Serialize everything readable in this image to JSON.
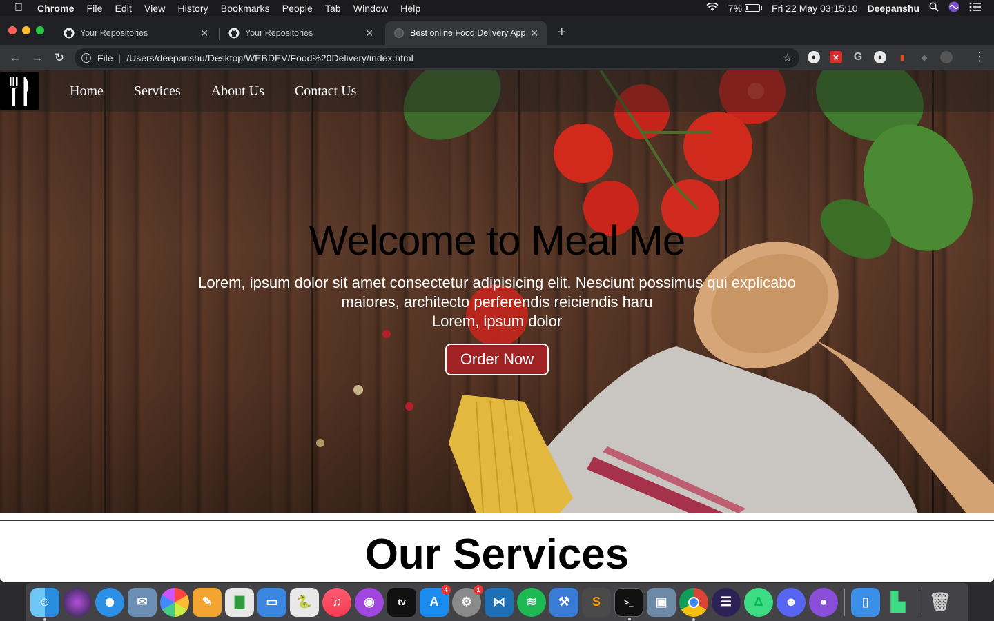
{
  "menubar": {
    "app": "Chrome",
    "items": [
      "File",
      "Edit",
      "View",
      "History",
      "Bookmarks",
      "People",
      "Tab",
      "Window",
      "Help"
    ],
    "battery": "7%",
    "battery_level": 0.07,
    "datetime": "Fri 22 May  03:15:10",
    "user": "Deepanshu"
  },
  "tabs": [
    {
      "title": "Your Repositories",
      "icon": "github-icon",
      "active": false
    },
    {
      "title": "Your Repositories",
      "icon": "github-icon",
      "active": false
    },
    {
      "title": "Best online Food Delivery App",
      "icon": "globe-icon",
      "active": true
    }
  ],
  "address": {
    "scheme": "File",
    "url": "/Users/deepanshu/Desktop/WEBDEV/Food%20Delivery/index.html"
  },
  "site": {
    "nav": [
      "Home",
      "Services",
      "About Us",
      "Contact Us"
    ],
    "hero_title": "Welcome to Meal Me",
    "hero_line1": "Lorem, ipsum dolor sit amet consectetur adipisicing elit. Nesciunt possimus qui explicabo",
    "hero_line2": "maiores, architecto perferendis reiciendis haru",
    "hero_line3": "Lorem, ipsum dolor",
    "order_button": "Order Now",
    "services_heading": "Our Services"
  },
  "dock": {
    "apps": [
      "Finder",
      "Siri",
      "Safari",
      "Preview",
      "Photos",
      "Pages",
      "Numbers",
      "Keynote",
      "Python",
      "Music",
      "Podcasts",
      "tv",
      "App Store",
      "System Preferences",
      "Visual Studio Code",
      "Spotify",
      "Xcode",
      "Sublime Text",
      "Terminal",
      "Image Capture",
      "Google Chrome",
      "Eclipse",
      "Android Studio",
      "Discord",
      "GitHub Desktop",
      "Simulator",
      "Android",
      "Trash"
    ],
    "badges": {
      "app_store": "4",
      "system_preferences": "1"
    },
    "tv_label": "tv"
  },
  "colors": {
    "order_button": "#a02224",
    "menubar_bg": "#1b1b1d",
    "tab_active": "#35363a"
  }
}
